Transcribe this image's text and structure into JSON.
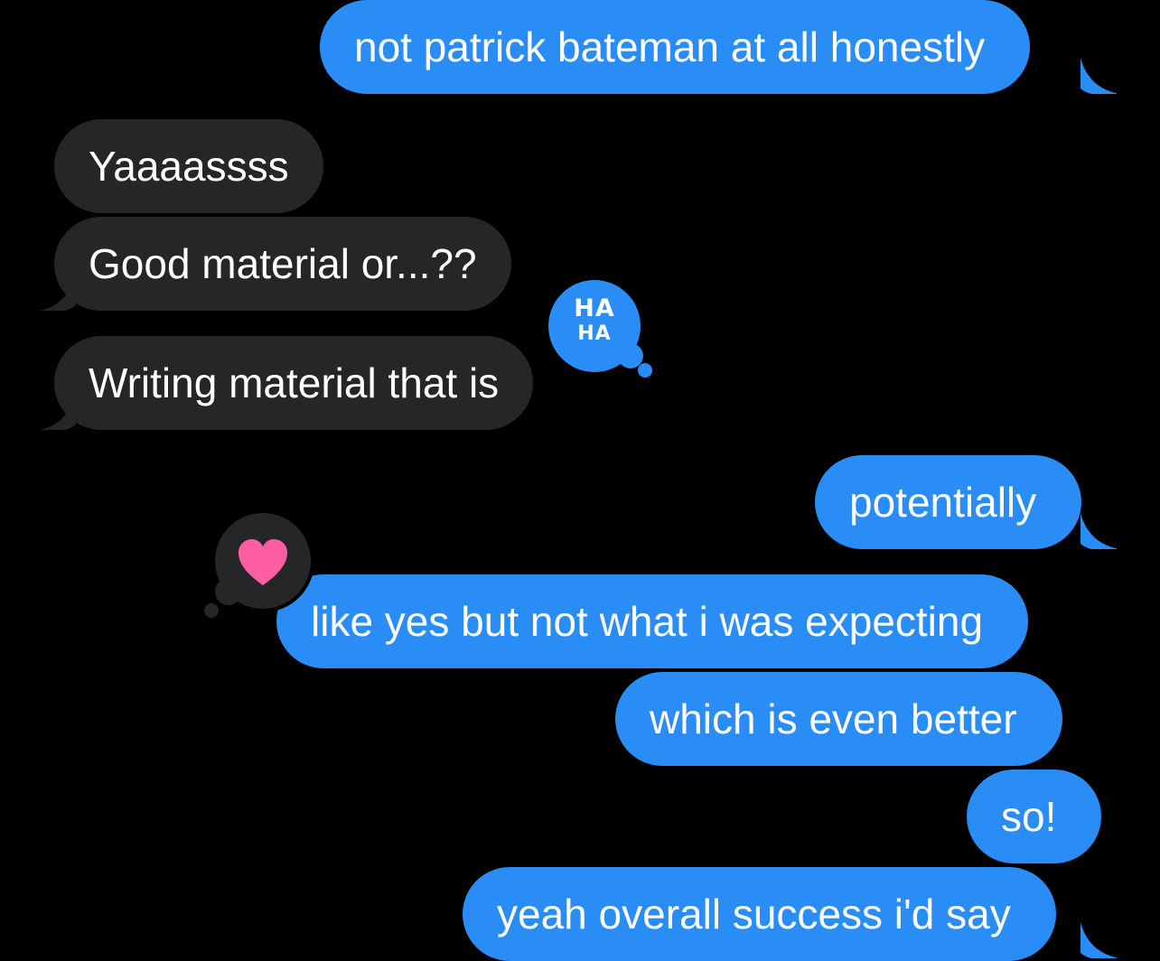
{
  "colors": {
    "background": "#000000",
    "outgoing_bubble": "#2a8cf5",
    "incoming_bubble": "#262629",
    "text": "#ffffff",
    "heart": "#ff5fa2"
  },
  "messages": [
    {
      "direction": "outgoing",
      "text": "not patrick bateman at all honestly"
    },
    {
      "direction": "incoming",
      "text": "Yaaaassss"
    },
    {
      "direction": "incoming",
      "text": "Good material or...??"
    },
    {
      "direction": "incoming",
      "text": "Writing material that is",
      "tapback": {
        "icon": "haha-icon",
        "label_top": "HA",
        "label_bottom": "HA"
      }
    },
    {
      "direction": "outgoing",
      "text": "potentially"
    },
    {
      "direction": "outgoing",
      "text": "like yes but not what i was expecting",
      "tapback": {
        "icon": "heart-icon"
      }
    },
    {
      "direction": "outgoing",
      "text": "which is even better"
    },
    {
      "direction": "outgoing",
      "text": "so!"
    },
    {
      "direction": "outgoing",
      "text": "yeah overall success i'd say"
    }
  ]
}
